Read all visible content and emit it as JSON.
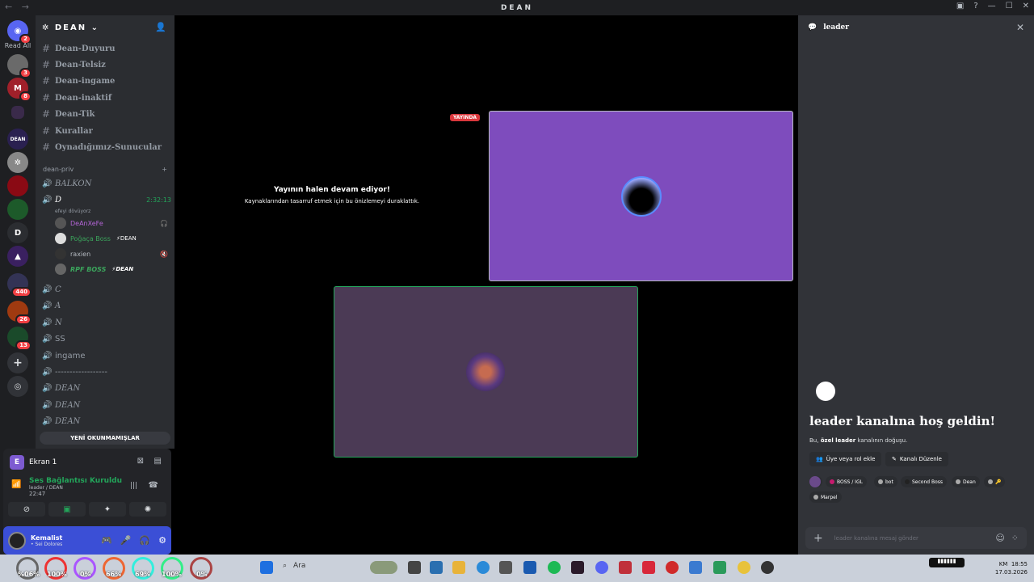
{
  "window": {
    "title": "DEAN",
    "nav": "← →"
  },
  "servers": {
    "read_all": "Read All",
    "badges": [
      "2",
      "3",
      "8",
      "440",
      "26",
      "13"
    ],
    "letter_server": "D",
    "dean_server": "DEAN"
  },
  "guild": {
    "name": "DEAN",
    "text_channels": [
      "Dean-Duyuru",
      "Dean-Telsiz",
      "Dean-ingame",
      "Dean-inaktif",
      "Dean-Tik",
      "Kurallar",
      "Oynadığımız-Sunucular"
    ],
    "category": "dean-priv",
    "voice_top": {
      "balkon": "BALKON",
      "d_channel": "D",
      "timer": "2:32:13",
      "sub": "efeyi dövüyorz"
    },
    "voice_users": [
      {
        "name": "DeAnXeFe",
        "tag": ""
      },
      {
        "name": "Poğaça Boss",
        "tag": "⚡DEAN"
      },
      {
        "name": "raxien",
        "tag": ""
      },
      {
        "name": "RPF BOSS",
        "tag": "⚡DEAN"
      }
    ],
    "voice_channels": [
      "C",
      "A",
      "N",
      "SS",
      "ingame",
      "------------------",
      "DEAN",
      "DEAN",
      "DEAN"
    ],
    "unread_button": "YENİ OKUNMAMIŞLAR"
  },
  "panel": {
    "stream_label": "Ekran 1",
    "stream_icon": "E",
    "connection": "Ses Bağlantısı Kuruldu",
    "channel": "leader / DEAN",
    "time": "22:47"
  },
  "user": {
    "name": "Kemalist",
    "status": "• Sei Dolores"
  },
  "stage": {
    "paused_title": "Yayının halen devam ediyor!",
    "paused_sub": "Kaynaklarından tasarruf etmek için bu önizlemeyi duraklattık.",
    "live_badge": "YAYINDA"
  },
  "chat": {
    "channel": "leader",
    "welcome": "leader kanalına hoş geldin!",
    "welcome_sub_prefix": "Bu, ",
    "welcome_sub_bold": "özel leader",
    "welcome_sub_suffix": " kanalının doğuşu.",
    "add_member": "Üye veya rol ekle",
    "edit_channel": "Kanalı Düzenle",
    "roles": [
      "BOSS / IGL",
      "bot",
      "Second Boss",
      "Dean",
      "🔑",
      "Marpel"
    ],
    "input_placeholder": "leader kanalına mesaj gönder"
  },
  "taskbar": {
    "gauges": [
      "%06%",
      "100%",
      "0%",
      "66%",
      "69%",
      "100%",
      "0%"
    ],
    "search": "Ara",
    "time": "18:55",
    "date": "17.03.2026",
    "keyboard": "KM"
  },
  "colors": {
    "accent": "#5865f2",
    "online": "#23a55a",
    "live": "#da373c",
    "tile_purple": "#7e4cbd"
  }
}
